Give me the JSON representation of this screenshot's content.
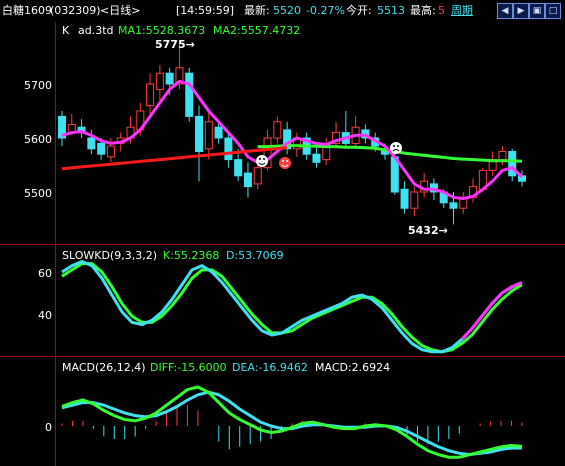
{
  "header": {
    "name": "白糖1609",
    "code": "(032309)",
    "period": "<日线>",
    "time": "[14:59:59]",
    "latest_label": "最新:",
    "latest_value": "5520",
    "change_pct": "-0.27%",
    "open_label": "今开:",
    "open_value": "5513",
    "high_label": "最高:",
    "high_value": "5",
    "cycle_label": "周期",
    "colors": {
      "up": "#ff3b3b",
      "down": "#3fe0f0",
      "ma1": "#ff33ff",
      "ma2": "#33ff33",
      "diff": "#33ff33",
      "dea": "#3fe0f0"
    }
  },
  "main_panel": {
    "label_k": "K",
    "label_adj": "ad.3td",
    "ma1_label": "MA1:5528.3673",
    "ma2_label": "MA2:5557.4732",
    "y_ticks": [
      "5700",
      "5600",
      "5500"
    ],
    "annot_high": "5775→",
    "annot_low": "5432→",
    "candles": [
      [
        5640,
        5600,
        5650,
        5585
      ],
      [
        5610,
        5625,
        5645,
        5605
      ],
      [
        5620,
        5610,
        5635,
        5600
      ],
      [
        5600,
        5580,
        5615,
        5570
      ],
      [
        5590,
        5570,
        5600,
        5560
      ],
      [
        5565,
        5585,
        5600,
        5555
      ],
      [
        5590,
        5600,
        5610,
        5575
      ],
      [
        5600,
        5620,
        5640,
        5590
      ],
      [
        5615,
        5650,
        5665,
        5605
      ],
      [
        5660,
        5700,
        5720,
        5640
      ],
      [
        5690,
        5720,
        5735,
        5670
      ],
      [
        5720,
        5700,
        5730,
        5680
      ],
      [
        5700,
        5730,
        5775,
        5690
      ],
      [
        5720,
        5640,
        5730,
        5630
      ],
      [
        5640,
        5575,
        5660,
        5520
      ],
      [
        5580,
        5630,
        5650,
        5560
      ],
      [
        5620,
        5600,
        5630,
        5590
      ],
      [
        5600,
        5560,
        5610,
        5545
      ],
      [
        5560,
        5530,
        5580,
        5520
      ],
      [
        5535,
        5510,
        5555,
        5490
      ],
      [
        5515,
        5545,
        5560,
        5505
      ],
      [
        5545,
        5600,
        5615,
        5540
      ],
      [
        5600,
        5630,
        5640,
        5590
      ],
      [
        5615,
        5580,
        5630,
        5570
      ],
      [
        5580,
        5600,
        5610,
        5565
      ],
      [
        5600,
        5570,
        5610,
        5560
      ],
      [
        5570,
        5555,
        5585,
        5545
      ],
      [
        5560,
        5590,
        5600,
        5550
      ],
      [
        5590,
        5610,
        5630,
        5585
      ],
      [
        5610,
        5590,
        5650,
        5580
      ],
      [
        5590,
        5620,
        5640,
        5580
      ],
      [
        5615,
        5600,
        5625,
        5590
      ],
      [
        5600,
        5585,
        5610,
        5575
      ],
      [
        5580,
        5570,
        5590,
        5560
      ],
      [
        5565,
        5500,
        5580,
        5495
      ],
      [
        5505,
        5470,
        5520,
        5460
      ],
      [
        5470,
        5500,
        5510,
        5455
      ],
      [
        5500,
        5520,
        5535,
        5490
      ],
      [
        5515,
        5500,
        5525,
        5485
      ],
      [
        5500,
        5480,
        5505,
        5470
      ],
      [
        5480,
        5470,
        5500,
        5440
      ],
      [
        5470,
        5490,
        5500,
        5460
      ],
      [
        5490,
        5510,
        5525,
        5480
      ],
      [
        5505,
        5540,
        5545,
        5500
      ],
      [
        5540,
        5560,
        5575,
        5530
      ],
      [
        5560,
        5575,
        5585,
        5550
      ],
      [
        5575,
        5530,
        5580,
        5520
      ],
      [
        5530,
        5520,
        5540,
        5510
      ]
    ],
    "ma1": [
      5605,
      5610,
      5612,
      5605,
      5595,
      5590,
      5592,
      5600,
      5615,
      5640,
      5665,
      5690,
      5705,
      5700,
      5675,
      5650,
      5630,
      5610,
      5590,
      5565,
      5555,
      5560,
      5575,
      5590,
      5600,
      5595,
      5590,
      5588,
      5595,
      5600,
      5605,
      5605,
      5595,
      5585,
      5565,
      5540,
      5515,
      5505,
      5505,
      5500,
      5490,
      5488,
      5492,
      5505,
      5520,
      5540,
      5545,
      5528
    ],
    "ma2": [
      5545,
      5548,
      5550,
      5552,
      5554,
      5556,
      5558,
      5560,
      5562,
      5565,
      5568,
      5572,
      5576,
      5580,
      5582,
      5583,
      5584,
      5586,
      5586,
      5585,
      5584,
      5584,
      5585,
      5586,
      5586,
      5585,
      5585,
      5584,
      5584,
      5583,
      5583,
      5582,
      5581,
      5578,
      5575,
      5572,
      5570,
      5568,
      5566,
      5564,
      5562,
      5561,
      5560,
      5559,
      5558,
      5558,
      5558,
      5557
    ]
  },
  "kd_panel": {
    "label": "SLOWKD(9,3,3,2)",
    "k_label": "K:55.2368",
    "d_label": "D:53.7069",
    "y_ticks": [
      "60",
      "40"
    ],
    "k": [
      60,
      63,
      65,
      63,
      57,
      49,
      41,
      36,
      35,
      37,
      41,
      47,
      54,
      61,
      63,
      60,
      55,
      49,
      43,
      37,
      32,
      30,
      31,
      34,
      37,
      39,
      41,
      43,
      45,
      48,
      49,
      47,
      43,
      37,
      31,
      26,
      23,
      22,
      22,
      24,
      28,
      33,
      39,
      45,
      50,
      53,
      55
    ],
    "d": [
      58,
      61,
      64,
      64,
      60,
      53,
      45,
      39,
      36,
      36,
      39,
      44,
      50,
      57,
      61,
      61,
      58,
      52,
      46,
      40,
      35,
      31,
      31,
      32,
      35,
      38,
      40,
      42,
      44,
      46,
      48,
      48,
      45,
      40,
      34,
      29,
      25,
      23,
      22,
      23,
      26,
      30,
      36,
      42,
      47,
      51,
      54
    ]
  },
  "macd_panel": {
    "label": "MACD(26,12,4)",
    "diff_label": "DIFF:-15.6000",
    "dea_label": "DEA:-16.9462",
    "macd_label": "MACD:2.6924",
    "y_ticks": [
      "0"
    ],
    "diff": [
      15,
      18,
      20,
      17,
      12,
      8,
      5,
      4,
      6,
      10,
      16,
      22,
      28,
      30,
      26,
      18,
      10,
      5,
      1,
      -3,
      -5,
      -4,
      -1,
      2,
      3,
      1,
      -1,
      -2,
      -2,
      0,
      1,
      0,
      -3,
      -8,
      -14,
      -19,
      -22,
      -24,
      -24,
      -22,
      -20,
      -18,
      -16,
      -15,
      -15.6
    ],
    "dea": [
      14,
      16,
      18,
      18,
      16,
      13,
      10,
      8,
      7,
      8,
      11,
      15,
      20,
      24,
      26,
      24,
      19,
      13,
      8,
      3,
      0,
      -2,
      -2,
      0,
      1,
      1,
      0,
      -1,
      -1,
      -1,
      0,
      0,
      -1,
      -4,
      -8,
      -12,
      -16,
      -19,
      -21,
      -22,
      -21,
      -20,
      -18,
      -17,
      -16.9
    ],
    "macd": [
      2,
      4,
      4,
      -2,
      -8,
      -10,
      -10,
      -8,
      -2,
      4,
      10,
      14,
      16,
      12,
      0,
      -12,
      -18,
      -16,
      -14,
      -12,
      -10,
      -4,
      2,
      4,
      4,
      0,
      -2,
      -2,
      -2,
      2,
      2,
      0,
      -4,
      -8,
      -12,
      -14,
      -12,
      -10,
      -6,
      0,
      2,
      4,
      4,
      4,
      2.7
    ]
  }
}
